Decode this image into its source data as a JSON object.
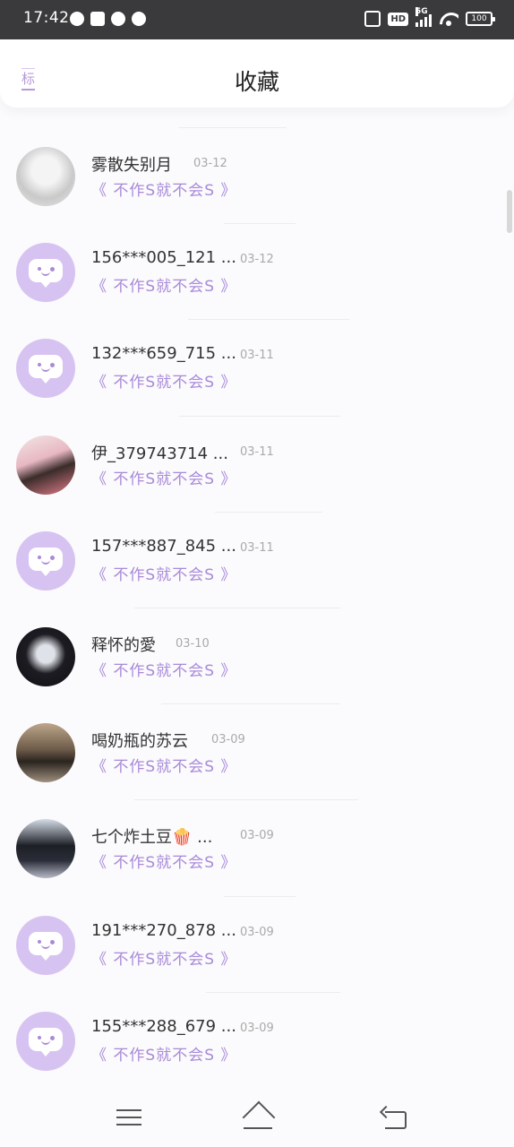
{
  "status_bar": {
    "time": "17:42",
    "hd_label": "HD",
    "network_label": "5G",
    "battery": "100"
  },
  "header": {
    "title": "收藏",
    "left_tag": "标"
  },
  "favorites": [
    {
      "name": "雾散失别月",
      "time": "03-12",
      "subtitle": "《 不作S就不会S 》",
      "avatar": "photo"
    },
    {
      "name": "156***005_121 ...",
      "time": "03-12",
      "subtitle": "《 不作S就不会S 》",
      "avatar": "default"
    },
    {
      "name": "132***659_715 ...",
      "time": "03-11",
      "subtitle": "《 不作S就不会S 》",
      "avatar": "default"
    },
    {
      "name": "伊_379743714 ...",
      "time": "03-11",
      "subtitle": "《 不作S就不会S 》",
      "avatar": "photo"
    },
    {
      "name": "157***887_845 ...",
      "time": "03-11",
      "subtitle": "《 不作S就不会S 》",
      "avatar": "default"
    },
    {
      "name": "释怀的愛",
      "time": "03-10",
      "subtitle": "《 不作S就不会S 》",
      "avatar": "photo"
    },
    {
      "name": "喝奶瓶的苏云",
      "time": "03-09",
      "subtitle": "《 不作S就不会S 》",
      "avatar": "photo"
    },
    {
      "name": "七个炸土豆🍿 ...",
      "time": "03-09",
      "subtitle": "《 不作S就不会S 》",
      "avatar": "photo"
    },
    {
      "name": "191***270_878 ...",
      "time": "03-09",
      "subtitle": "《 不作S就不会S 》",
      "avatar": "default"
    },
    {
      "name": "155***288_679 ...",
      "time": "03-09",
      "subtitle": "《 不作S就不会S 》",
      "avatar": "default"
    }
  ],
  "colors": {
    "accent": "#a88ad9",
    "default_avatar_bg": "#d7c3f1",
    "status_bar_bg": "#3a3a3c"
  },
  "nav_bar": {
    "icons": [
      "menu-icon",
      "home-icon",
      "back-icon"
    ]
  }
}
